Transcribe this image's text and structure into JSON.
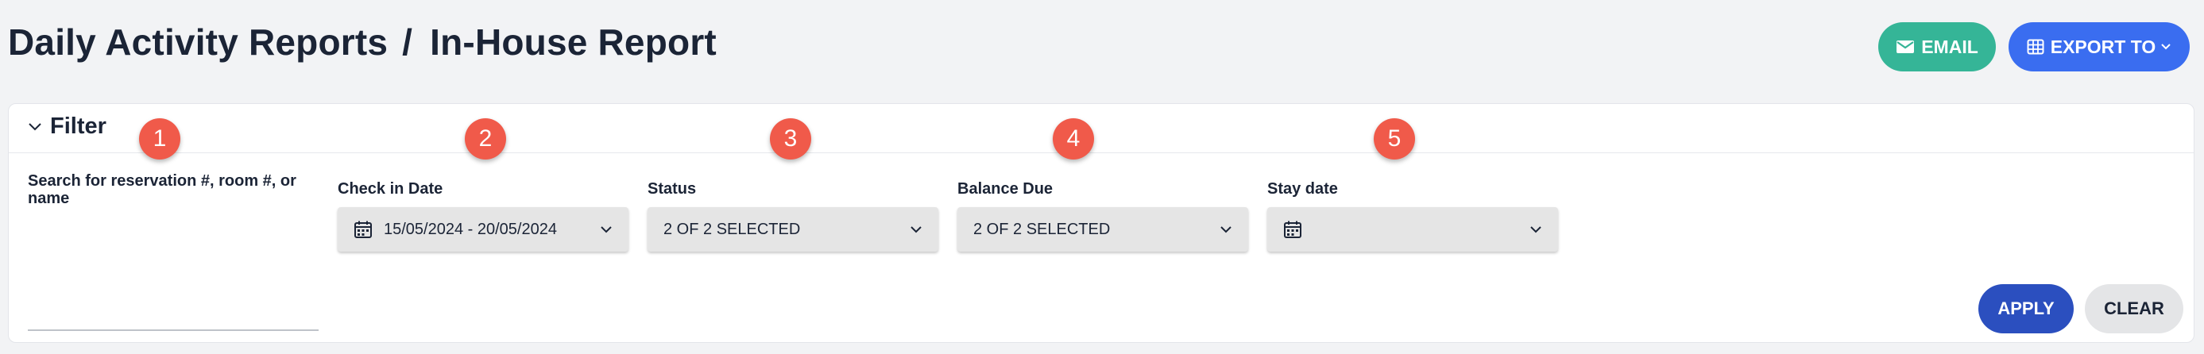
{
  "header": {
    "title_left": "Daily Activity Reports",
    "separator": "/",
    "title_right": "In-House Report",
    "email_label": "EMAIL",
    "export_label": "EXPORT TO"
  },
  "filter": {
    "title": "Filter",
    "markers": [
      "1",
      "2",
      "3",
      "4",
      "5"
    ],
    "search": {
      "label": "Search for reservation #, room #, or name",
      "value": ""
    },
    "check_in": {
      "label": "Check in Date",
      "value": "15/05/2024 - 20/05/2024"
    },
    "status": {
      "label": "Status",
      "value": "2 OF 2 SELECTED"
    },
    "balance_due": {
      "label": "Balance Due",
      "value": "2 OF 2 SELECTED"
    },
    "stay_date": {
      "label": "Stay date",
      "value": ""
    },
    "apply_label": "APPLY",
    "clear_label": "CLEAR"
  },
  "colors": {
    "email": "#35b597",
    "export": "#3a6df0",
    "apply": "#2b4fbf",
    "marker": "#f05a4a"
  },
  "icons": [
    "envelope-icon",
    "table-grid-icon",
    "chevron-down-icon",
    "calendar-icon"
  ]
}
